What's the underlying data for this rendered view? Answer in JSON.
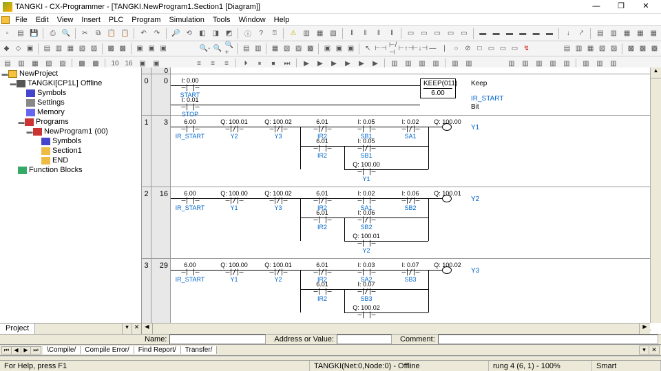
{
  "title": "TANGKI - CX-Programmer - [TANGKI.NewProgram1.Section1 [Diagram]]",
  "menu": [
    "File",
    "Edit",
    "View",
    "Insert",
    "PLC",
    "Program",
    "Simulation",
    "Tools",
    "Window",
    "Help"
  ],
  "tree": {
    "root": "NewProject",
    "plc": "TANGKI[CP1L] Offline",
    "nodes": {
      "symbols": "Symbols",
      "settings": "Settings",
      "memory": "Memory",
      "programs": "Programs",
      "np1": "NewProgram1 (00)",
      "np1_sym": "Symbols",
      "section": "Section1",
      "end": "END",
      "fb": "Function Blocks"
    },
    "tab": "Project"
  },
  "ladder_header": "0",
  "rungs": [
    {
      "num": "0",
      "step": "0",
      "right_labels": {
        "k": "Keep",
        "ir": "IR_START",
        "bit": "Bit"
      },
      "box": {
        "title": "KEEP(011)",
        "val": "6.00"
      },
      "rows": [
        {
          "elems": [
            {
              "addr": "I: 0.00",
              "name": "START",
              "type": "no"
            }
          ]
        },
        {
          "elems": [
            {
              "addr": "I: 0.01",
              "name": "STOP",
              "type": "no"
            }
          ]
        }
      ]
    },
    {
      "num": "1",
      "step": "3",
      "output": {
        "addr": "Q: 100.00",
        "name": "Y1"
      },
      "row1": [
        {
          "addr": "6.00",
          "name": "IR_START",
          "type": "no"
        },
        {
          "addr": "Q: 100.01",
          "name": "Y2",
          "type": "nc"
        },
        {
          "addr": "Q: 100.02",
          "name": "Y3",
          "type": "nc"
        },
        {
          "addr": "6.01",
          "name": "IR2",
          "type": "nc"
        },
        {
          "addr": "I: 0.05",
          "name": "SB1",
          "type": "no"
        },
        {
          "addr": "I: 0.02",
          "name": "SA1",
          "type": "nc"
        }
      ],
      "row2": [
        {
          "addr": "6.01",
          "name": "IR2",
          "type": "no"
        },
        {
          "addr": "I: 0.05",
          "name": "SB1",
          "type": "nc"
        }
      ],
      "row3": [
        {
          "addr": "Q: 100.00",
          "name": "Y1",
          "type": "no"
        }
      ]
    },
    {
      "num": "2",
      "step": "16",
      "output": {
        "addr": "Q: 100.01",
        "name": "Y2"
      },
      "row1": [
        {
          "addr": "6.00",
          "name": "IR_START",
          "type": "no"
        },
        {
          "addr": "Q: 100.00",
          "name": "Y1",
          "type": "nc"
        },
        {
          "addr": "Q: 100.02",
          "name": "Y3",
          "type": "nc"
        },
        {
          "addr": "6.01",
          "name": "IR2",
          "type": "nc"
        },
        {
          "addr": "I: 0.02",
          "name": "SA1",
          "type": "no"
        },
        {
          "addr": "I: 0.06",
          "name": "SB2",
          "type": "nc"
        }
      ],
      "row2": [
        {
          "addr": "6.01",
          "name": "IR2",
          "type": "no"
        },
        {
          "addr": "I: 0.06",
          "name": "SB2",
          "type": "nc"
        }
      ],
      "row3": [
        {
          "addr": "Q: 100.01",
          "name": "Y2",
          "type": "no"
        }
      ]
    },
    {
      "num": "3",
      "step": "29",
      "output": {
        "addr": "Q: 100.02",
        "name": "Y3"
      },
      "row1": [
        {
          "addr": "6.00",
          "name": "IR_START",
          "type": "no"
        },
        {
          "addr": "Q: 100.00",
          "name": "Y1",
          "type": "nc"
        },
        {
          "addr": "Q: 100.01",
          "name": "Y2",
          "type": "nc"
        },
        {
          "addr": "6.01",
          "name": "IR2",
          "type": "nc"
        },
        {
          "addr": "I: 0.03",
          "name": "SA2",
          "type": "no"
        },
        {
          "addr": "I: 0.07",
          "name": "SB3",
          "type": "nc"
        }
      ],
      "row2": [
        {
          "addr": "6.01",
          "name": "IR2",
          "type": "no"
        },
        {
          "addr": "I: 0.07",
          "name": "SB3",
          "type": "nc"
        }
      ],
      "row3": [
        {
          "addr": "Q: 100.02",
          "name": ""
        }
      ]
    }
  ],
  "name_bar": {
    "name": "Name:",
    "addr": "Address or Value:",
    "comment": "Comment:"
  },
  "btm_tabs": [
    "Compile",
    "Compile Error",
    "Find Report",
    "Transfer"
  ],
  "status": {
    "help": "For Help, press F1",
    "net": "TANGKI(Net:0,Node:0) - Offline",
    "rung": "rung 4 (6, 1)  - 100%",
    "mode": "Smart"
  }
}
